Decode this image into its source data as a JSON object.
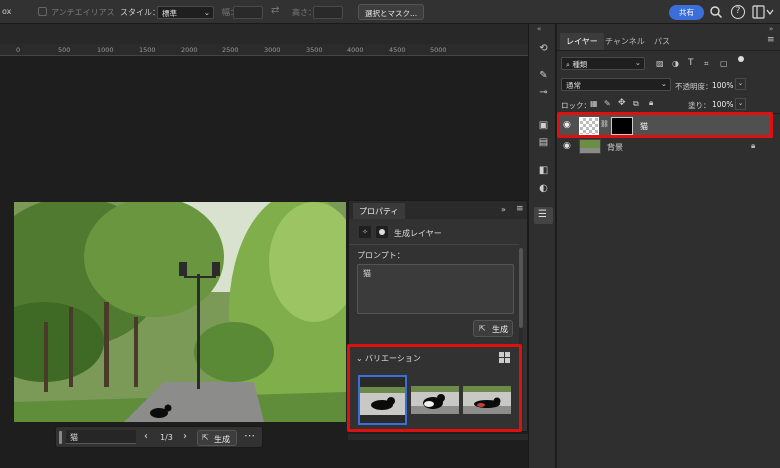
{
  "options_bar": {
    "left_fragment": "ox",
    "antialias_label": "アンチエイリアス",
    "style_label": "スタイル：",
    "style_value": "標準",
    "width_label": "幅：",
    "height_label": "高さ：",
    "select_mask_button": "選択とマスク...",
    "share_button": "共有"
  },
  "ruler": {
    "ticks": [
      "0",
      "500",
      "1000",
      "1500",
      "2000",
      "2500",
      "3000",
      "3500",
      "4000",
      "4500",
      "5000"
    ]
  },
  "layers_panel": {
    "tabs": [
      "レイヤー",
      "チャンネル",
      "パス"
    ],
    "active_tab": "レイヤー",
    "filter_kind": "種類",
    "blend_mode": "通常",
    "opacity_label": "不透明度：",
    "opacity_value": "100%",
    "lock_label": "ロック：",
    "fill_label": "塗り：",
    "fill_value": "100%",
    "layers": [
      {
        "name": "猫",
        "selected": true
      },
      {
        "name": "背景",
        "selected": false
      }
    ]
  },
  "properties_panel": {
    "title": "プロパティ",
    "layer_type": "生成レイヤー",
    "prompt_label": "プロンプト：",
    "prompt_text": "猫",
    "generate_button": "生成",
    "variations_label": "バリエーション"
  },
  "context_bar": {
    "prompt": "猫",
    "page": "1/3",
    "generate_button": "生成"
  },
  "colors": {
    "highlight_red": "#e01010",
    "accent_blue": "#3a6fd9"
  }
}
